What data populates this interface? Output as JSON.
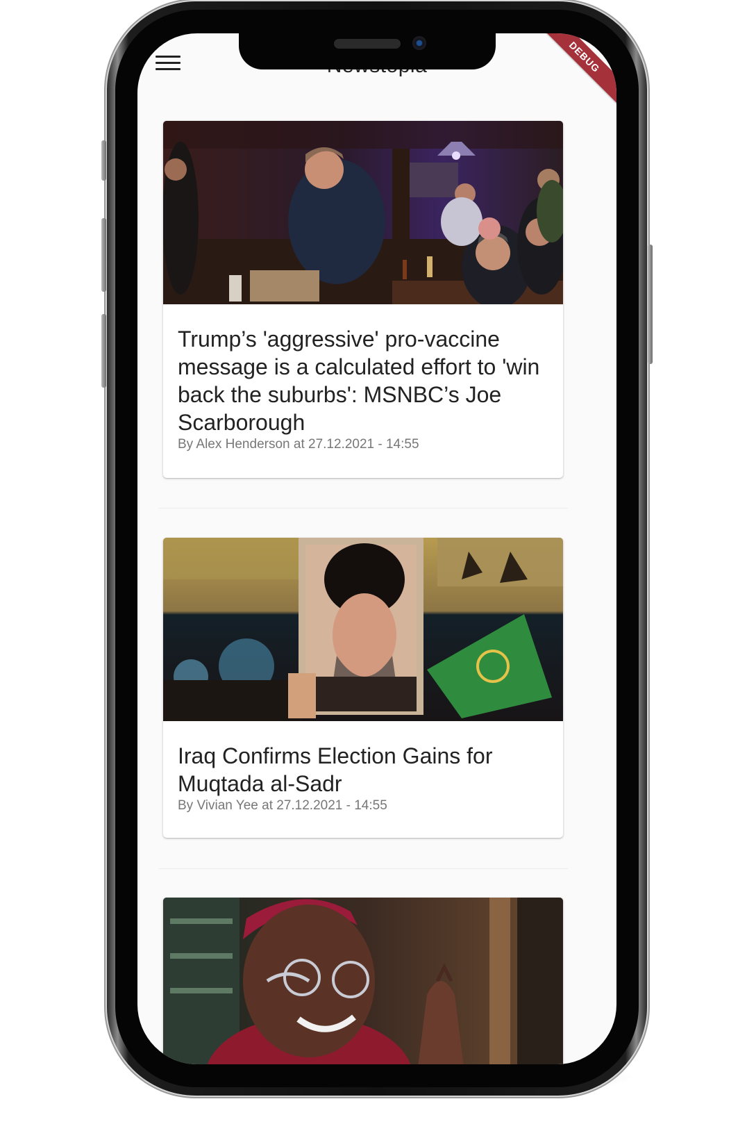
{
  "app": {
    "title": "Newstopia",
    "debug_banner": "DEBUG"
  },
  "articles": [
    {
      "title": "Trump’s 'aggressive' pro-vaccine message is a calculated effort to 'win back the suburbs': MSNBC’s Joe Scarborough",
      "byline": "By Alex Henderson at 27.12.2021 - 14:55",
      "image": "tv-interview-in-diner-photo"
    },
    {
      "title": "Iraq Confirms Election Gains for Muqtada al-Sadr",
      "byline": "By Vivian Yee at 27.12.2021 - 14:55",
      "image": "portrait-poster-with-crowd-and-green-flag-photo"
    },
    {
      "title": "",
      "byline": "",
      "image": "smiling-elderly-man-in-glasses-photo"
    }
  ],
  "icons": {
    "menu": "hamburger-menu-icon"
  }
}
